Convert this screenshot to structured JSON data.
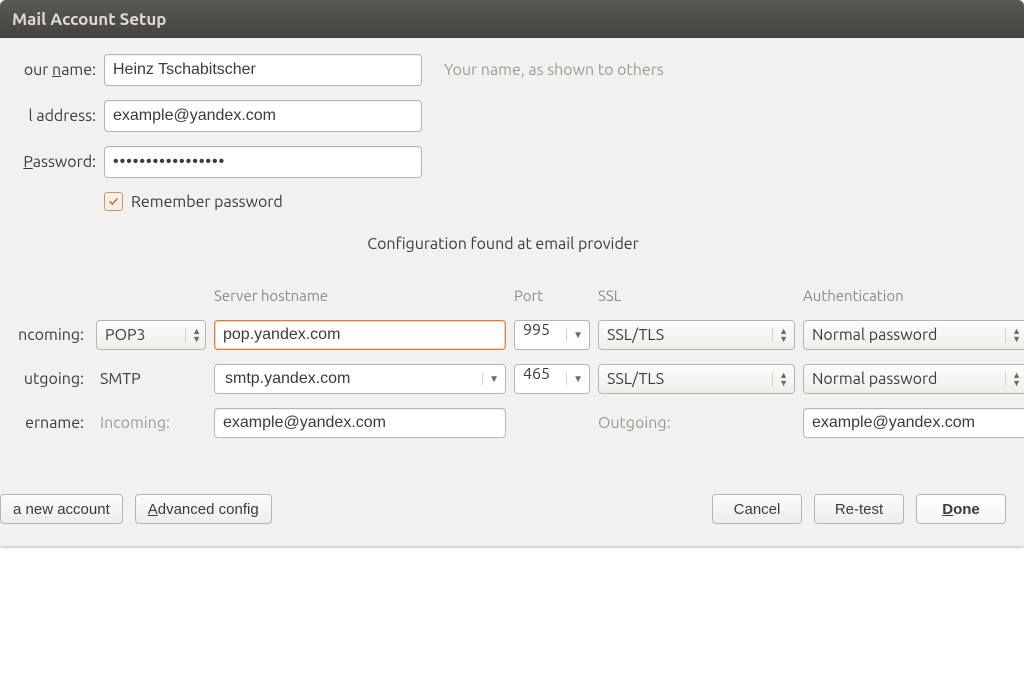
{
  "title": "Mail Account Setup",
  "labels": {
    "your_name_pre": "our ",
    "your_name_under": "n",
    "your_name_post": "ame:",
    "email_addr": "l address:",
    "password_under": "P",
    "password_post": "assword:",
    "remember": "Remember password",
    "hint": "Your name, as shown to others",
    "config_msg": "Configuration found at email provider",
    "server_hostname": "Server hostname",
    "port": "Port",
    "ssl": "SSL",
    "authentication": "Authentication",
    "incoming": "ncoming:",
    "outgoing_row": "utgoing:",
    "username": "ername:",
    "username_incoming": "Incoming:",
    "username_outgoing": "Outgoing:",
    "smtp_static": "SMTP"
  },
  "values": {
    "your_name": "Heinz Tschabitscher",
    "email": "example@yandex.com",
    "password_mask": "•••••••••••••••••",
    "remember_checked": true,
    "incoming_protocol": "POP3",
    "incoming_host": "pop.yandex.com",
    "incoming_port": "995",
    "incoming_ssl": "SSL/TLS",
    "incoming_auth": "Normal password",
    "outgoing_host": "smtp.yandex.com",
    "outgoing_port": "465",
    "outgoing_ssl": "SSL/TLS",
    "outgoing_auth": "Normal password",
    "username_incoming": "example@yandex.com",
    "username_outgoing": "example@yandex.com"
  },
  "buttons": {
    "get_new_account": "a new account",
    "advanced_under": "A",
    "advanced_post": "dvanced config",
    "cancel": "Cancel",
    "retest": "Re-test",
    "done_under": "D",
    "done_post": "one"
  }
}
